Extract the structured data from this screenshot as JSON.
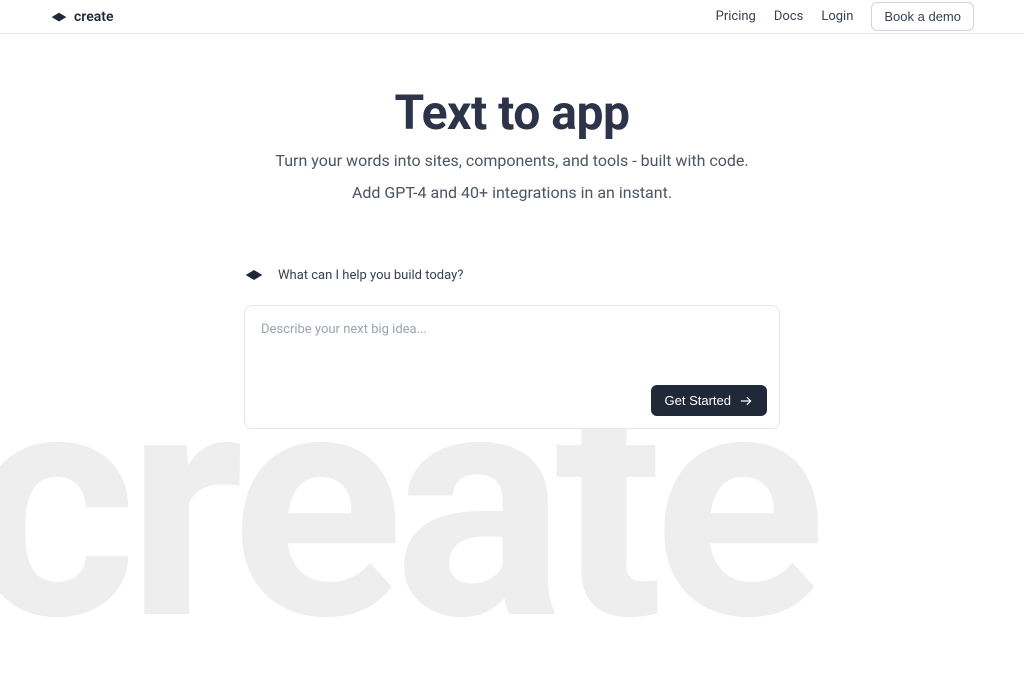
{
  "header": {
    "logo_text": "create",
    "nav": {
      "pricing": "Pricing",
      "docs": "Docs",
      "login": "Login",
      "demo": "Book a demo"
    }
  },
  "hero": {
    "title": "Text to app",
    "subtitle_line1": "Turn your words into sites, components, and tools - built with code.",
    "subtitle_line2": "Add GPT-4 and 40+ integrations in an instant."
  },
  "prompt": {
    "label": "What can I help you build today?",
    "placeholder": "Describe your next big idea...",
    "button": "Get Started"
  },
  "background": {
    "text": "create"
  }
}
